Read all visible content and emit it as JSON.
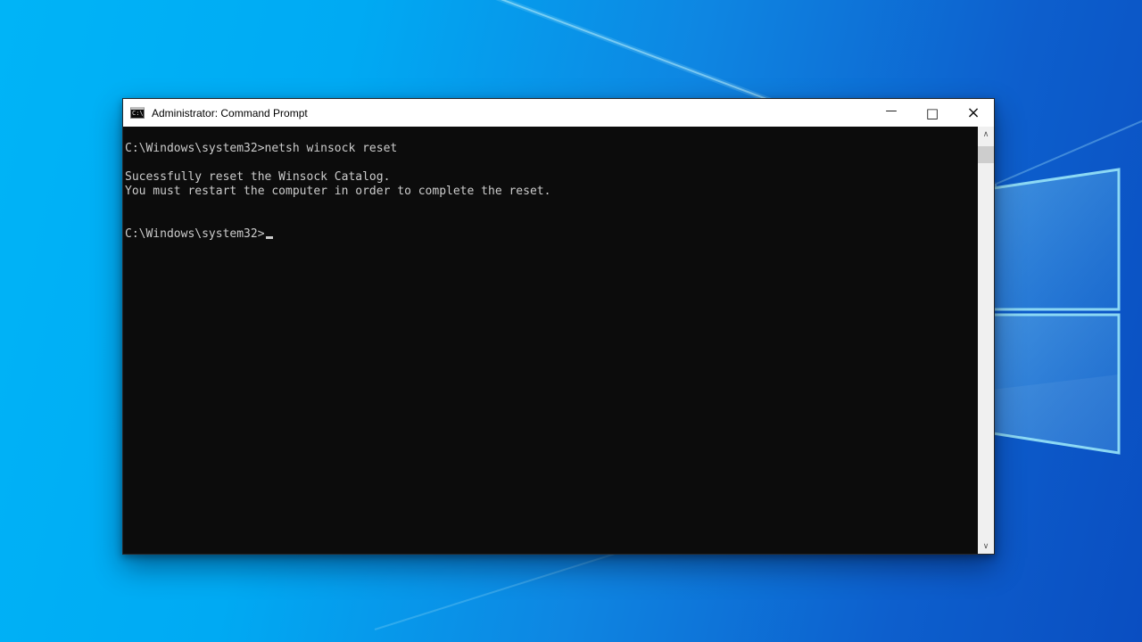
{
  "window": {
    "title": "Administrator: Command Prompt",
    "icon_text": "C:\\_",
    "controls": {
      "minimize": "—",
      "maximize": "□",
      "close": "×"
    }
  },
  "terminal": {
    "lines": [
      "C:\\Windows\\system32>netsh winsock reset",
      "",
      "Sucessfully reset the Winsock Catalog.",
      "You must restart the computer in order to complete the reset.",
      "",
      "",
      "C:\\Windows\\system32>"
    ],
    "scrollbar": {
      "up_glyph": "∧",
      "down_glyph": "∨"
    }
  },
  "wallpaper": {
    "left_color": "#00b4f7",
    "right_color": "#0a4ec1",
    "logo_border_color": "#98e4f8",
    "terminal_bg": "#0c0c0c",
    "terminal_text_color": "#cccccc"
  }
}
